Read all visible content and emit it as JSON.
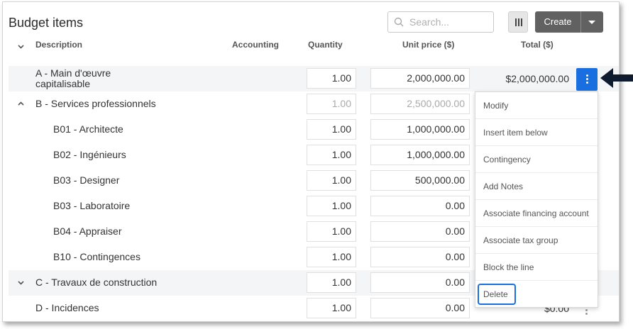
{
  "title": "Budget items",
  "search": {
    "placeholder": "Search..."
  },
  "toolbar": {
    "create_label": "Create"
  },
  "columns": {
    "description": "Description",
    "accounting": "Accounting",
    "quantity": "Quantity",
    "unit_price": "Unit price ($)",
    "total": "Total ($)"
  },
  "rows": [
    {
      "desc1": "A - Main d'œuvre",
      "desc2": "capitalisable",
      "qty": "1.00",
      "unit_price": "2,000,000.00",
      "total": "$2,000,000.00"
    },
    {
      "desc": "B - Services professionnels",
      "qty": "1.00",
      "unit_price": "2,500,000.00"
    },
    {
      "desc": "B01 - Architecte",
      "qty": "1.00",
      "unit_price": "1,000,000.00"
    },
    {
      "desc": "B02 - Ingénieurs",
      "qty": "1.00",
      "unit_price": "1,000,000.00"
    },
    {
      "desc": "B03 - Designer",
      "qty": "1.00",
      "unit_price": "500,000.00"
    },
    {
      "desc": "B03 - Laboratoire",
      "qty": "1.00",
      "unit_price": "0.00"
    },
    {
      "desc": "B04 - Appraiser",
      "qty": "1.00",
      "unit_price": "0.00"
    },
    {
      "desc": "B10 - Contingences",
      "qty": "1.00",
      "unit_price": "0.00"
    },
    {
      "desc": "C - Travaux de construction",
      "qty": "1.00",
      "unit_price": "0.00"
    },
    {
      "desc": "D - Incidences",
      "qty": "1.00",
      "unit_price": "0.00",
      "total": "$0.00"
    }
  ],
  "menu": [
    "Modify",
    "Insert item below",
    "Contingency",
    "Add Notes",
    "Associate financing account",
    "Associate tax group",
    "Block the line",
    "Delete"
  ],
  "colors": {
    "accent": "#1a6fe0",
    "create_bg": "#616161",
    "row_band": "#f4f5f7"
  },
  "icons": [
    "search-icon",
    "columns-icon",
    "caret-down-icon",
    "chevron-down-icon",
    "chevron-up-icon",
    "kebab-icon",
    "arrow-left-icon"
  ]
}
